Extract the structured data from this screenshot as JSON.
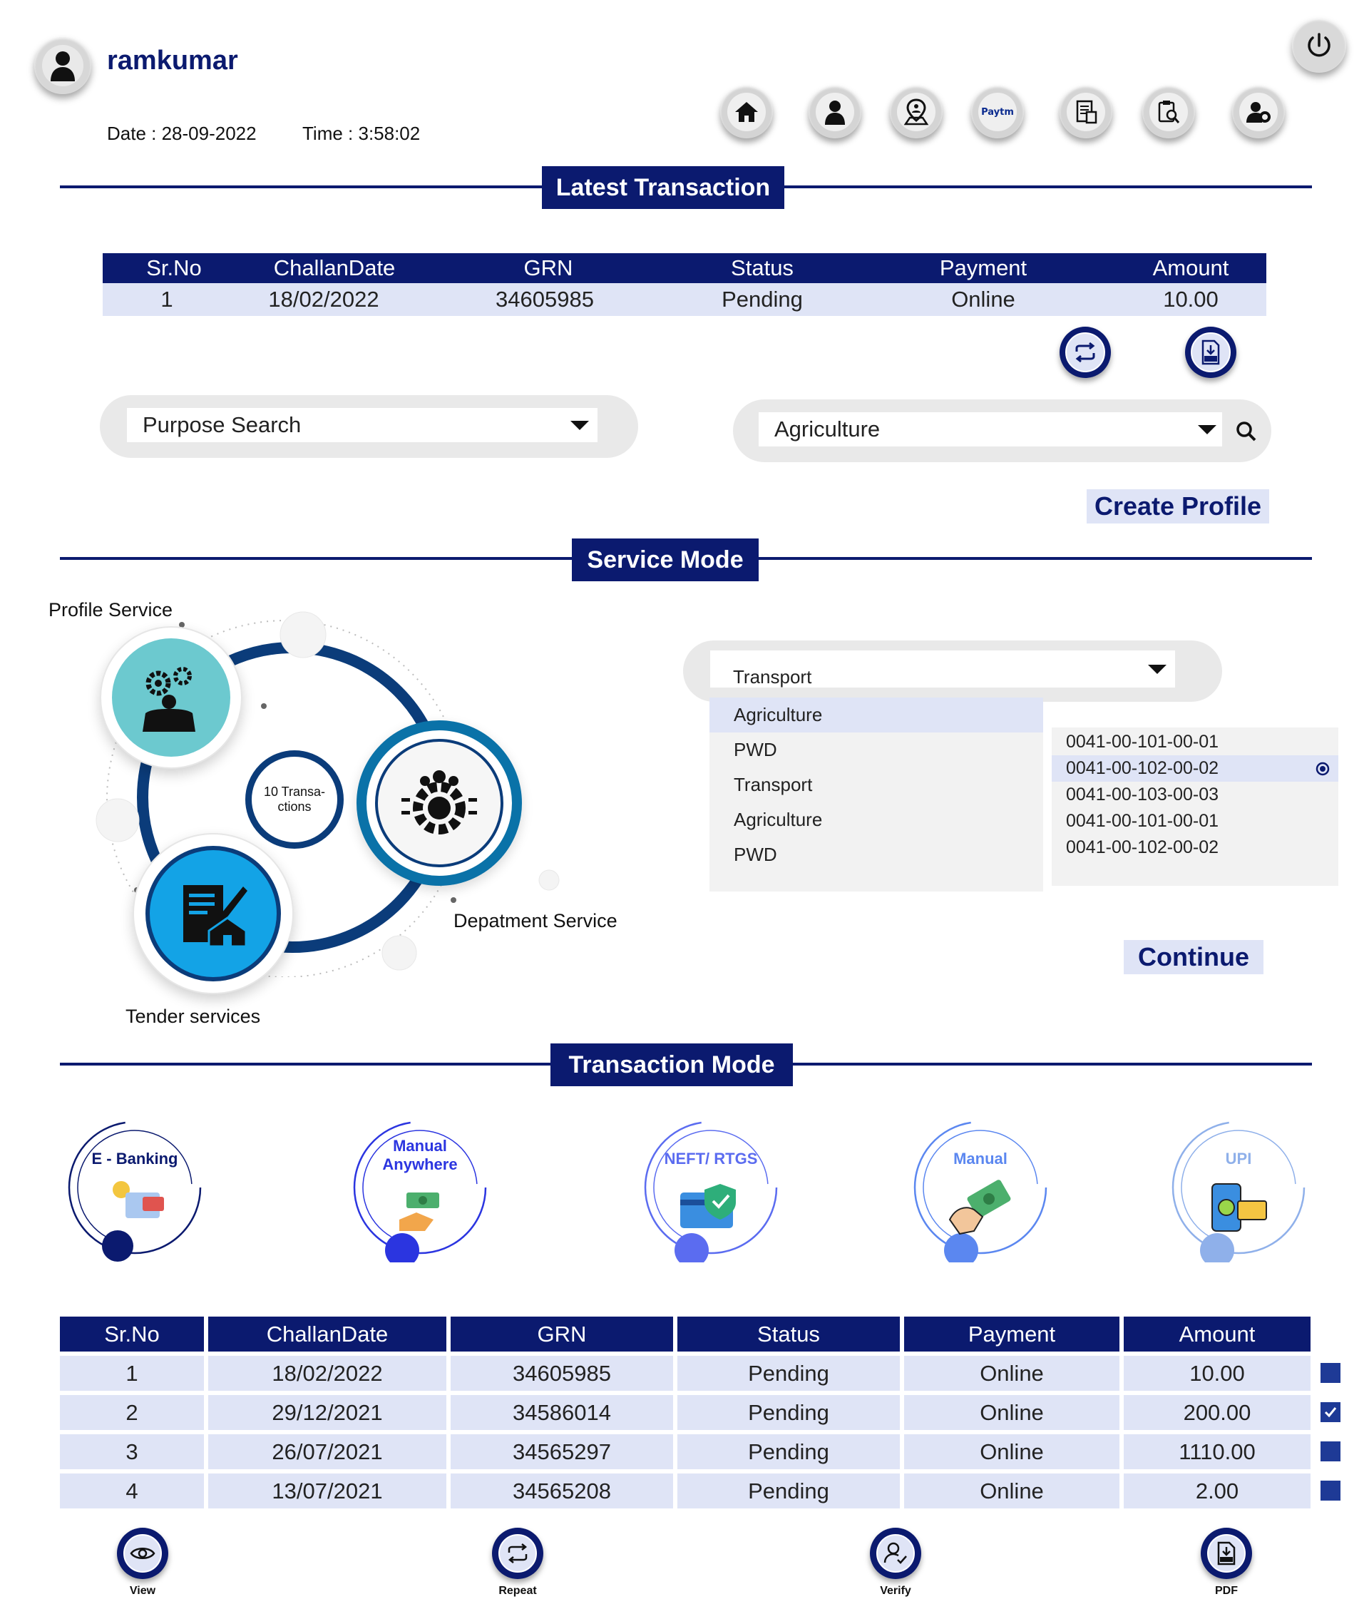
{
  "header": {
    "username": "ramkumar",
    "date": "Date : 28-09-2022",
    "time": "Time : 3:58:02",
    "nav_icons": [
      "home-icon",
      "user-icon",
      "location-icon",
      "paytm-icon",
      "receipt-icon",
      "search-document-icon",
      "user-settings-icon"
    ],
    "paytm_text": "Paytm"
  },
  "latest": {
    "title": "Latest Transaction",
    "columns": [
      "Sr.No",
      "ChallanDate",
      "GRN",
      "Status",
      "Payment",
      "Amount"
    ],
    "row": [
      "1",
      "18/02/2022",
      "34605985",
      "Pending",
      "Online",
      "10.00"
    ]
  },
  "search": {
    "purpose_value": "Purpose Search",
    "department_value": "Agriculture",
    "create_profile": "Create Profile"
  },
  "service": {
    "title": "Service Mode",
    "profile_label": "Profile Service",
    "center_text_1": "10 Transa-",
    "center_text_2": "ctions",
    "department_label": "Depatment Service",
    "tender_label": "Tender services",
    "dropdown_value": "Transport",
    "options": [
      "Agriculture",
      "PWD",
      "Transport",
      "Agriculture",
      "PWD"
    ],
    "selected_option": 0,
    "codes": [
      "0041-00-101-00-01",
      "0041-00-102-00-02",
      "0041-00-103-00-03",
      "0041-00-101-00-01",
      "0041-00-102-00-02"
    ],
    "selected_code": 1,
    "continue": "Continue"
  },
  "transaction_mode": {
    "title": "Transaction Mode",
    "modes": [
      {
        "label1": "E - Banking",
        "label2": "",
        "color": "#0b1a6f"
      },
      {
        "label1": "Manual",
        "label2": "Anywhere",
        "color": "#2b35e0"
      },
      {
        "label1": "NEFT/ RTGS",
        "label2": "",
        "color": "#5b6cf0"
      },
      {
        "label1": "Manual",
        "label2": "",
        "color": "#5b87f0"
      },
      {
        "label1": "UPI",
        "label2": "",
        "color": "#8fb0ea"
      }
    ]
  },
  "history": {
    "columns": [
      "Sr.No",
      "ChallanDate",
      "GRN",
      "Status",
      "Payment",
      "Amount"
    ],
    "rows": [
      {
        "sr": "1",
        "date": "18/02/2022",
        "grn": "34605985",
        "status": "Pending",
        "payment": "Online",
        "amount": "10.00",
        "checked": false
      },
      {
        "sr": "2",
        "date": "29/12/2021",
        "grn": "34586014",
        "status": "Pending",
        "payment": "Online",
        "amount": "200.00",
        "checked": true
      },
      {
        "sr": "3",
        "date": "26/07/2021",
        "grn": "34565297",
        "status": "Pending",
        "payment": "Online",
        "amount": "1110.00",
        "checked": false
      },
      {
        "sr": "4",
        "date": "13/07/2021",
        "grn": "34565208",
        "status": "Pending",
        "payment": "Online",
        "amount": "2.00",
        "checked": false
      }
    ]
  },
  "actions": {
    "view": "View",
    "repeat": "Repeat",
    "verify": "Verify",
    "pdf": "PDF"
  },
  "colors": {
    "navy": "#0b1a6f",
    "light_blue": "#dfe4f6",
    "teal": "#6cc9cf",
    "cyan": "#13a3e6"
  }
}
